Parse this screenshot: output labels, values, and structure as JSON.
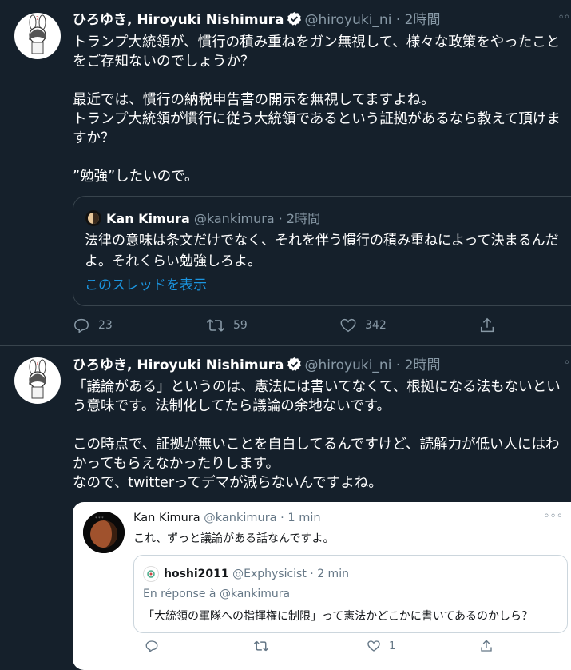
{
  "tweets": [
    {
      "author_name": "ひろゆき, Hiroyuki Nishimura",
      "handle": "@hiroyuki_ni",
      "time": "· 2時間",
      "more": "◦◦",
      "text": "トランプ大統領が、慣行の積み重ねをガン無視して、様々な政策をやったことをご存知ないのでしょうか？\n\n最近では、慣行の納税申告書の開示を無視してますよね。\nトランプ大統領が慣行に従う大統領であるという証拠があるなら教えて頂けますか？\n\n”勉強”したいので。",
      "quote": {
        "author_name": "Kan Kimura",
        "handle": "@kankimura",
        "time": "· 2時間",
        "text": "法律の意味は条文だけでなく、それを伴う慣行の積み重ねによって決まるんだよ。それくらい勉強しろよ。",
        "thread_link": "このスレッドを表示"
      },
      "actions": {
        "replies": "23",
        "retweets": "59",
        "likes": "342"
      }
    },
    {
      "author_name": "ひろゆき, Hiroyuki Nishimura",
      "handle": "@hiroyuki_ni",
      "time": "· 2時間",
      "more": "◦",
      "text": "「議論がある」というのは、憲法には書いてなくて、根拠になる法もないという意味です。法制化してたら議論の余地ないです。\n\nこの時点で、証拠が無いことを自白してるんですけど、読解力が低い人にはわかってもらえなかったりします。\nなので、twitterってデマが減らないんですよね。",
      "embed": {
        "author_name": "Kan Kimura",
        "handle": "@kankimura",
        "time": "· 1 min",
        "more": "◦◦◦",
        "text": "これ、ずっと議論がある話なんですよ。",
        "quote": {
          "author_name": "hoshi2011",
          "handle": "@Exphysicist",
          "time": "· 2 min",
          "reply_to": "En réponse à @kankimura",
          "text": "「大統領の軍隊への指揮権に制限」って憲法かどこかに書いてあるのかしら？"
        },
        "actions": {
          "likes": "1"
        }
      }
    }
  ],
  "colors": {
    "background": "#15202b",
    "secondary_text": "#8899a6",
    "link": "#1b95e0",
    "border": "#38444d",
    "verified": "#ffffff"
  }
}
